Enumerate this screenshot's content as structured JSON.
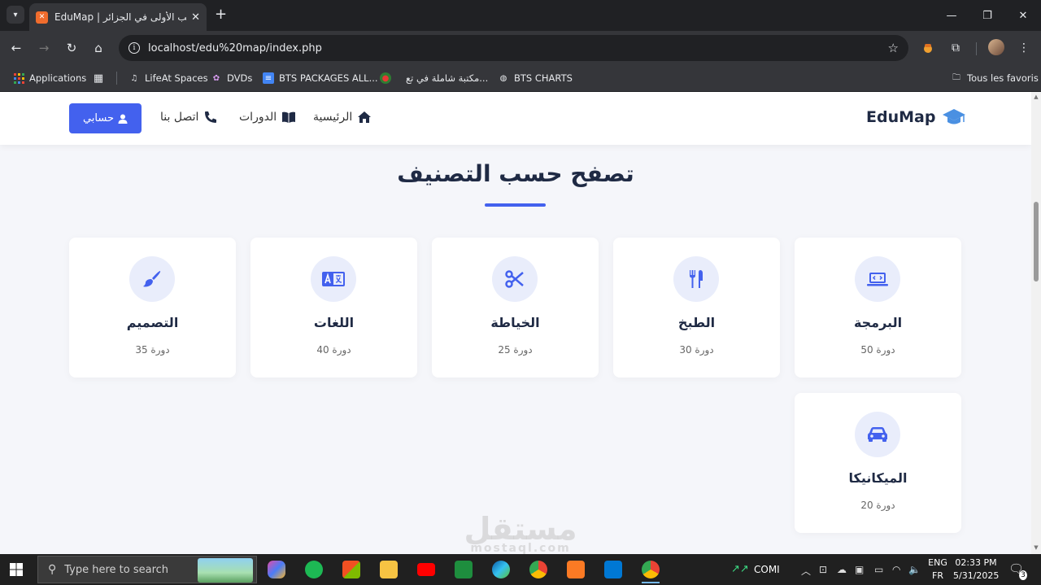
{
  "browser": {
    "tab_title": "EduMap | منصة التدريب الأولى في الجزائر",
    "url": "localhost/edu%20map/index.php",
    "bookmarks": [
      {
        "label": "Applications"
      },
      {
        "label": "LifeAt Spaces"
      },
      {
        "label": "DVDs"
      },
      {
        "label": "BTS PACKAGES ALL..."
      },
      {
        "label": "مكتبة شاملة في تع..."
      },
      {
        "label": "BTS CHARTS"
      }
    ],
    "all_bookmarks": "Tous les favoris"
  },
  "site": {
    "logo": "EduMap",
    "nav": {
      "home": "الرئيسية",
      "courses": "الدورات",
      "contact": "اتصل بنا"
    },
    "account_button": "حسابي",
    "section_title": "تصفح حسب التصنيف",
    "categories": [
      {
        "name": "البرمجة",
        "count": "50 دورة",
        "icon": "laptop-code-icon"
      },
      {
        "name": "الطبخ",
        "count": "30 دورة",
        "icon": "utensils-icon"
      },
      {
        "name": "الخياطة",
        "count": "25 دورة",
        "icon": "scissors-icon"
      },
      {
        "name": "اللغات",
        "count": "40 دورة",
        "icon": "language-icon"
      },
      {
        "name": "التصميم",
        "count": "35 دورة",
        "icon": "paint-brush-icon"
      },
      {
        "name": "الميكانيكا",
        "count": "20 دورة",
        "icon": "car-icon"
      }
    ],
    "accent": "#4361ee"
  },
  "watermark": {
    "main": "مستقل",
    "sub": "mostaql.com"
  },
  "taskbar": {
    "search_placeholder": "Type here to search",
    "stock": "COMI",
    "lang": "ENG",
    "layout": "FR",
    "time": "02:33 PM",
    "date": "5/31/2025",
    "notifications": "3"
  }
}
